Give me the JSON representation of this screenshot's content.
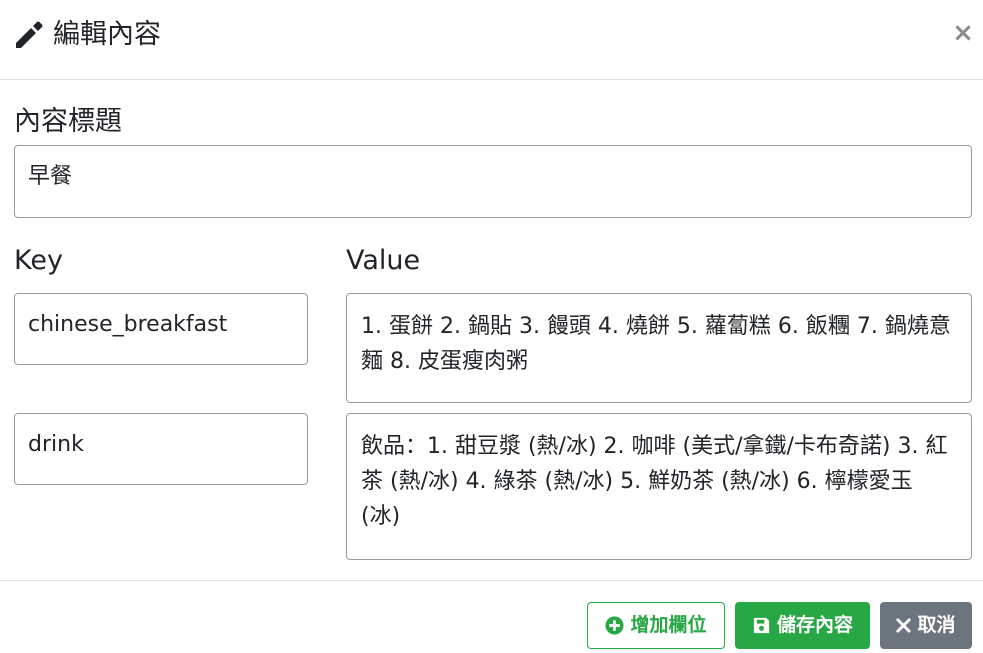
{
  "header": {
    "title": "編輯內容",
    "icon": "pencil-icon",
    "close_label": "×"
  },
  "form": {
    "title_label": "內容標題",
    "title_value": "早餐",
    "key_label": "Key",
    "value_label": "Value",
    "rows": [
      {
        "key": "chinese_breakfast",
        "value": "1. 蛋餅 2. 鍋貼 3. 饅頭 4. 燒餅 5. 蘿蔔糕 6. 飯糰 7. 鍋燒意麵 8. 皮蛋瘦肉粥"
      },
      {
        "key": "drink",
        "value": "飲品：1. 甜豆漿 (熱/冰) 2. 咖啡 (美式/拿鐵/卡布奇諾) 3. 紅茶 (熱/冰) 4. 綠茶 (熱/冰) 5. 鮮奶茶 (熱/冰) 6. 檸檬愛玉 (冰)"
      }
    ]
  },
  "footer": {
    "add_field_label": "增加欄位",
    "save_label": "儲存內容",
    "cancel_label": "取消"
  },
  "colors": {
    "success": "#28a745",
    "secondary": "#6c757d",
    "border": "#9a9a9a"
  }
}
